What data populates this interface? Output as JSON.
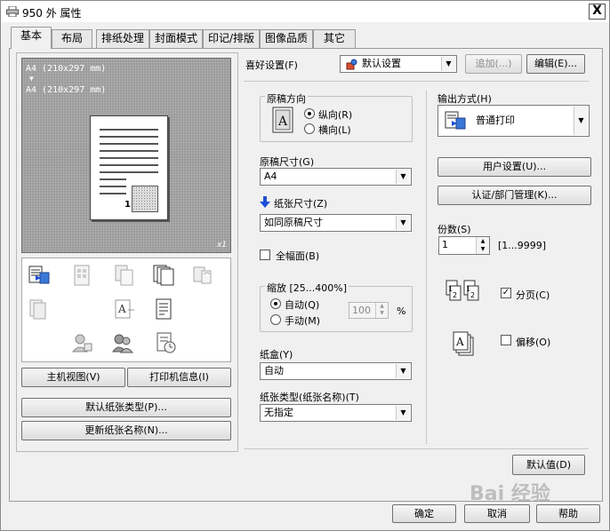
{
  "window": {
    "title": "950 外 属性",
    "close_glyph": "X"
  },
  "tabs": [
    {
      "label": "基本",
      "active": true
    },
    {
      "label": "布局",
      "active": false
    },
    {
      "label": "排纸处理",
      "active": false
    },
    {
      "label": "封面模式",
      "active": false
    },
    {
      "label": "印记/排版",
      "active": false
    },
    {
      "label": "图像品质",
      "active": false
    },
    {
      "label": "其它",
      "active": false
    }
  ],
  "preview": {
    "line1": "A4 (210x297 mm)",
    "arrow": "▼",
    "line2": "A4 (210x297 mm)",
    "page_number": "1",
    "copies_badge": "x1"
  },
  "left_buttons": {
    "host_view": "主机视图(V)",
    "printer_info": "打印机信息(I)",
    "default_paper_type": "默认纸张类型(P)...",
    "update_paper_name": "更新纸张名称(N)..."
  },
  "favorites": {
    "label": "喜好设置(F)",
    "value": "默认设置",
    "add_button": "追加(...)",
    "edit_button": "编辑(E)..."
  },
  "orientation": {
    "group_title": "原稿方向",
    "portrait": "纵向(R)",
    "landscape": "横向(L)",
    "selected": "portrait"
  },
  "original_size": {
    "label": "原稿尺寸(G)",
    "value": "A4"
  },
  "paper_size": {
    "label": "纸张尺寸(Z)",
    "value": "如同原稿尺寸"
  },
  "full_bleed": {
    "label": "全幅面(B)",
    "checked": false
  },
  "zoom": {
    "group_title": "缩放 [25...400%]",
    "auto": "自动(Q)",
    "manual": "手动(M)",
    "value": "100",
    "unit": "%",
    "selected": "auto"
  },
  "tray": {
    "label": "纸盒(Y)",
    "value": "自动"
  },
  "paper_type": {
    "label": "纸张类型(纸张名称)(T)",
    "value": "无指定"
  },
  "output": {
    "label": "输出方式(H)",
    "value": "普通打印"
  },
  "right_buttons": {
    "user_settings": "用户设置(U)...",
    "auth_dept": "认证/部门管理(K)..."
  },
  "copies": {
    "label": "份数(S)",
    "value": "1",
    "range": "[1...9999]"
  },
  "collate": {
    "label": "分页(C)",
    "checked": true
  },
  "offset": {
    "label": "偏移(O)",
    "checked": false
  },
  "defaults_button": "默认值(D)",
  "dialog_buttons": {
    "ok": "确定",
    "cancel": "取消",
    "help": "帮助"
  },
  "watermark": "Bai 经验",
  "colors": {
    "preview_bg": "#9c9c9c",
    "accent_arrow": "#1f4fd6",
    "window_bg": "#f0f0f0"
  }
}
